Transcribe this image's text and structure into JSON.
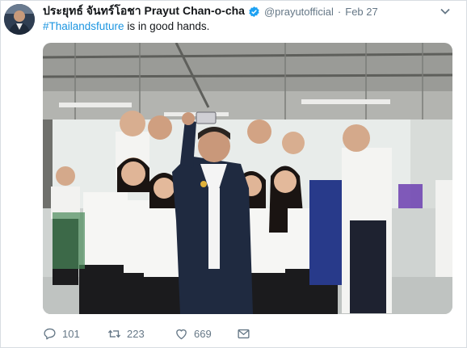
{
  "author": {
    "name": "ประยุทธ์ จันทร์โอชา Prayut Chan-o-cha",
    "handle": "@prayutofficial",
    "separator": "·",
    "date": "Feb 27"
  },
  "tweet": {
    "hashtag": "#Thailandsfuture",
    "text": " is in good hands."
  },
  "stats": {
    "replies": "101",
    "retweets": "223",
    "likes": "669"
  },
  "icons": [
    "verified-badge-icon",
    "chevron-down-icon",
    "reply-icon",
    "retweet-icon",
    "like-icon",
    "direct-message-icon"
  ],
  "colors": {
    "link": "#1b95e0",
    "muted": "#657786",
    "verified": "#1da1f2"
  }
}
